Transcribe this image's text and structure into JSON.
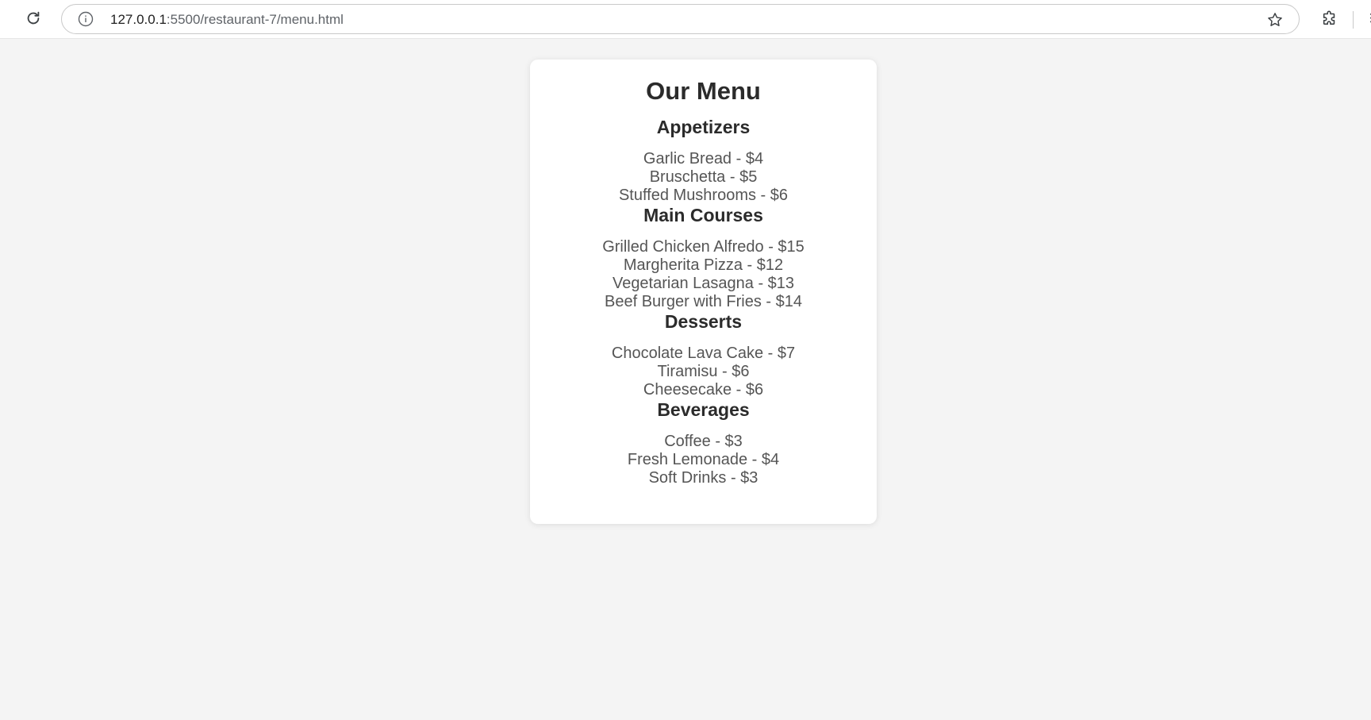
{
  "browser": {
    "url_host": "127.0.0.1",
    "url_path": ":5500/restaurant-7/menu.html",
    "icons": {
      "reload": "reload-icon",
      "info": "info-icon",
      "bookmark": "star-icon",
      "extensions": "puzzle-icon"
    }
  },
  "menu": {
    "title": "Our Menu",
    "sections": [
      {
        "title": "Appetizers",
        "items": [
          "Garlic Bread - $4",
          "Bruschetta - $5",
          "Stuffed Mushrooms - $6"
        ]
      },
      {
        "title": "Main Courses",
        "items": [
          "Grilled Chicken Alfredo - $15",
          "Margherita Pizza - $12",
          "Vegetarian Lasagna - $13",
          "Beef Burger with Fries - $14"
        ]
      },
      {
        "title": "Desserts",
        "items": [
          "Chocolate Lava Cake - $7",
          "Tiramisu - $6",
          "Cheesecake - $6"
        ]
      },
      {
        "title": "Beverages",
        "items": [
          "Coffee - $3",
          "Fresh Lemonade - $4",
          "Soft Drinks - $3"
        ]
      }
    ]
  },
  "colors": {
    "page_background": "#f4f4f4",
    "card_background": "#ffffff",
    "heading_text": "#2b2b2b",
    "item_text": "#555555"
  }
}
